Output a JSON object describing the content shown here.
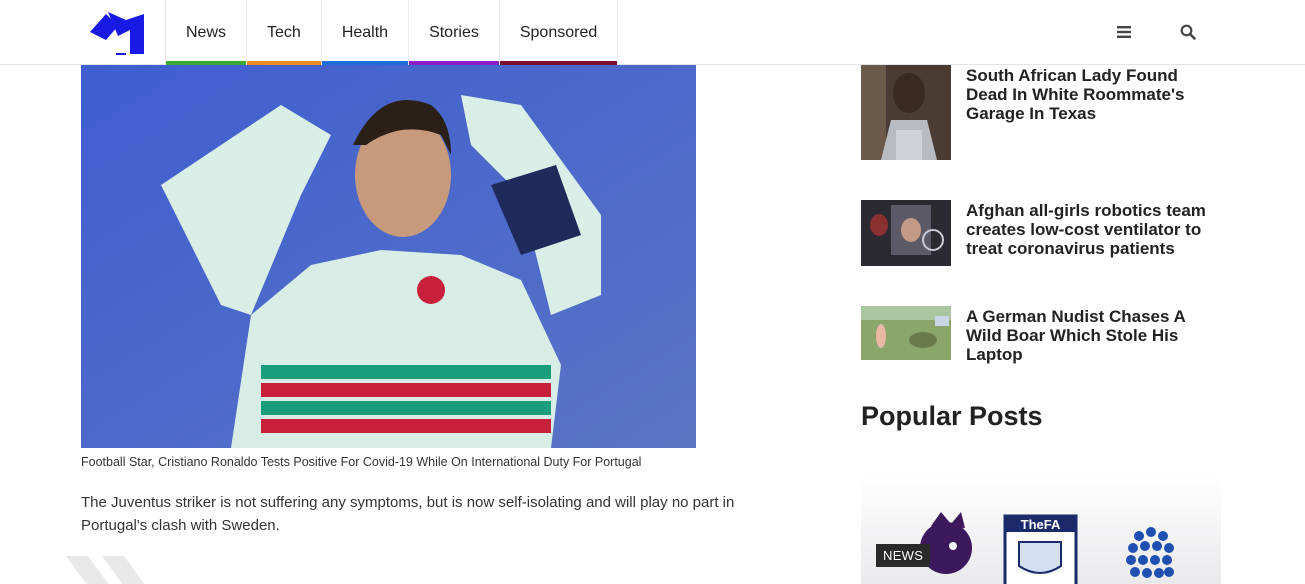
{
  "header": {
    "logo_icon": "site-logo-icon",
    "nav": [
      {
        "label": "News",
        "color": "#3aaa35"
      },
      {
        "label": "Tech",
        "color": "#f08a1d"
      },
      {
        "label": "Health",
        "color": "#1e6fd9"
      },
      {
        "label": "Stories",
        "color": "#8a1cc9"
      },
      {
        "label": "Sponsored",
        "color": "#7a1030"
      }
    ],
    "menu_icon": "hamburger-icon",
    "search_icon": "search-icon"
  },
  "article": {
    "caption": "Football Star, Cristiano Ronaldo Tests Positive For Covid-19 While On International Duty For Portugal",
    "paragraph": "The Juventus striker is not suffering any symptoms, but is now self-isolating and will play no part in Portugal's clash with Sweden."
  },
  "sidebar": {
    "related": [
      {
        "title": "South African Lady Found Dead In White Roommate's Garage In Texas"
      },
      {
        "title": "Afghan all-girls robotics team creates low-cost ventilator to treat coronavirus patients"
      },
      {
        "title": "A German Nudist Chases A Wild Boar Which Stole His Laptop"
      }
    ],
    "popular_heading": "Popular Posts",
    "popular_badge": "NEWS",
    "fa_label": "TheFA"
  },
  "colors": {
    "accent_blue": "#1a1ae6",
    "text": "#222222"
  }
}
